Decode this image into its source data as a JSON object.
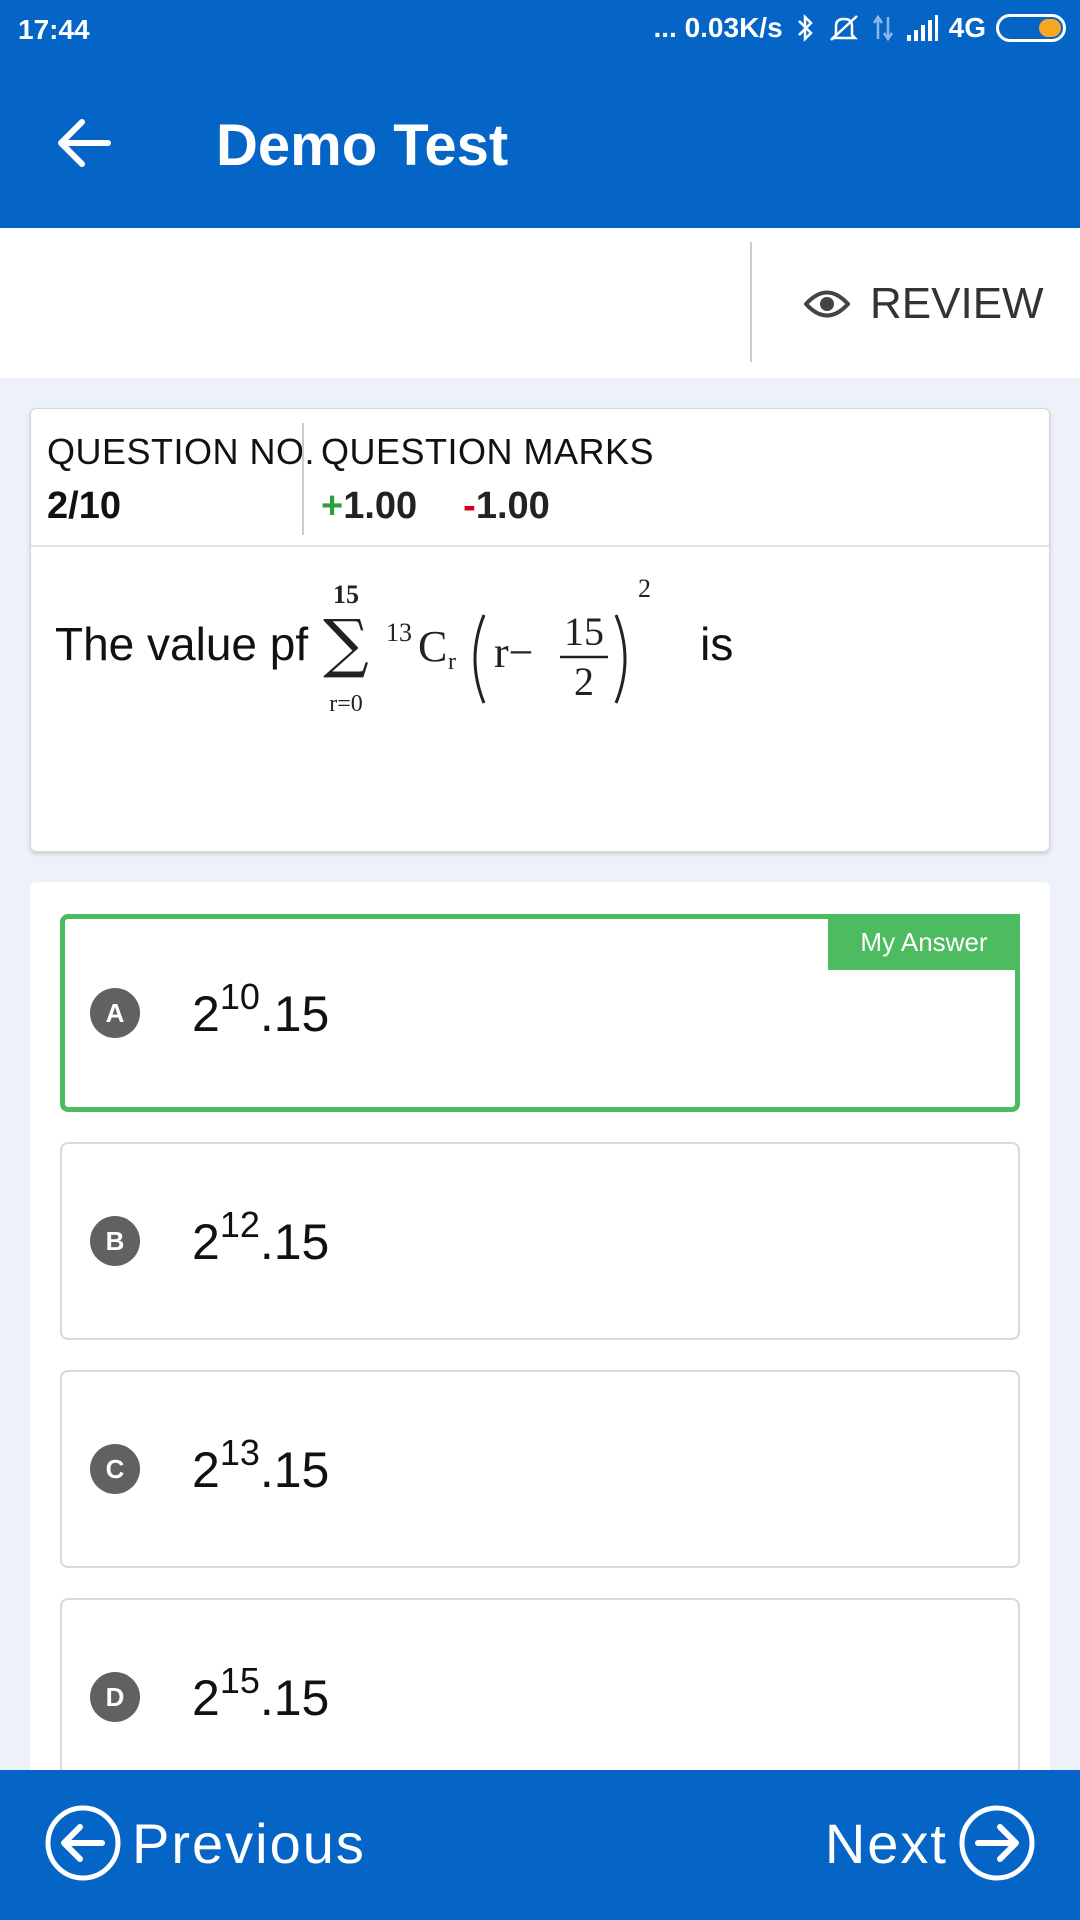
{
  "status_bar": {
    "time": "17:44",
    "network_speed": "... 0.03K/s",
    "network_type": "4G",
    "icons": [
      "bluetooth-icon",
      "mute-icon",
      "data-arrows-icon",
      "signal-icon",
      "battery-icon"
    ]
  },
  "app_bar": {
    "title": "Demo Test",
    "back_icon": "arrow-left-icon"
  },
  "toolbar": {
    "review_label": "REVIEW",
    "review_icon": "eye-icon"
  },
  "question": {
    "no_label": "QUESTION NO.",
    "no_value": "2/10",
    "marks_label": "QUESTION MARKS",
    "positive_marks": "+1.00",
    "negative_marks": "-1.00",
    "text_before": "The value pf",
    "text_after": "is",
    "formula": {
      "sum_upper": "15",
      "sum_lower": "r=0",
      "binom_n": "13",
      "binom_c": "C",
      "binom_r": "r",
      "inner": "r−",
      "frac_num": "15",
      "frac_den": "2",
      "power": "2"
    }
  },
  "options": [
    {
      "letter": "A",
      "base": "2",
      "exp": "10",
      "tail": ".15",
      "selected": true
    },
    {
      "letter": "B",
      "base": "2",
      "exp": "12",
      "tail": ".15",
      "selected": false
    },
    {
      "letter": "C",
      "base": "2",
      "exp": "13",
      "tail": ".15",
      "selected": false
    },
    {
      "letter": "D",
      "base": "2",
      "exp": "15",
      "tail": ".15",
      "selected": false
    }
  ],
  "my_answer_label": "My Answer",
  "bottom_nav": {
    "previous_label": "Previous",
    "next_label": "Next"
  },
  "colors": {
    "primary": "#0565c6",
    "correct_green": "#4dbb5f",
    "positive": "#2e9e3e",
    "negative": "#d0021b",
    "badge": "#616161"
  }
}
